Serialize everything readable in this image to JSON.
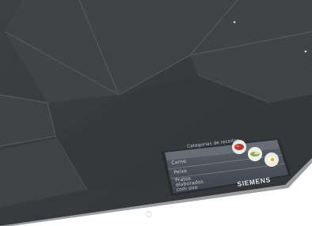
{
  "display": {
    "title": "Categorias de receitas",
    "items": [
      {
        "label": "Carne"
      },
      {
        "label": "Peixe"
      },
      {
        "label": "Pratos elaborados com ovo"
      }
    ]
  },
  "brand": {
    "name": "SIEMENS"
  },
  "icons": {
    "power": "power-icon",
    "zone_dot_top": "indicator-dot-icon",
    "zone_dot_right": "indicator-dot-icon"
  },
  "colors": {
    "glass": "#3f4245",
    "glass_dark": "#34373a",
    "zone_line": "#55585b",
    "screen_bg": "#4a5057",
    "screen_header": "#6a7179",
    "text": "#e6e8ea"
  }
}
